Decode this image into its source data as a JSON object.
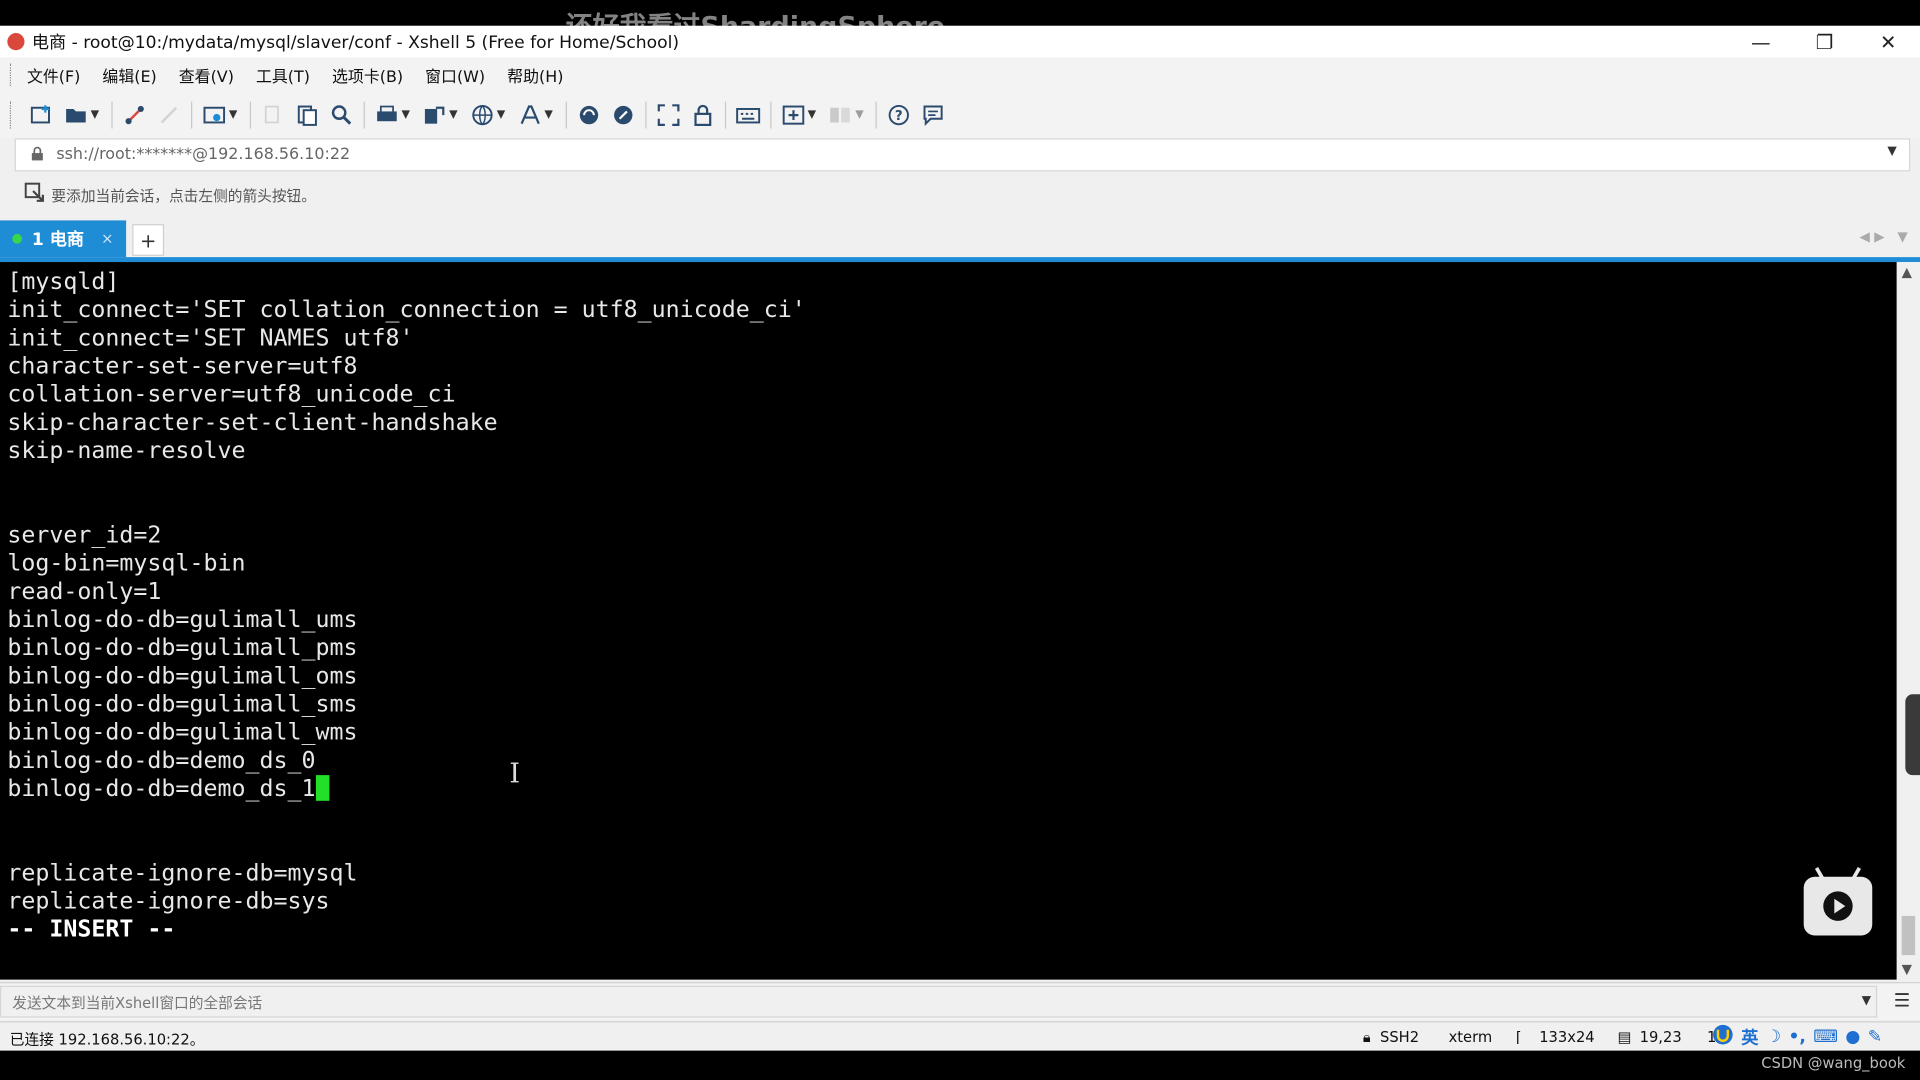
{
  "watermark": "还好我看过ShardingSphere",
  "window": {
    "title": "电商 - root@10:/mydata/mysql/slaver/conf - Xshell 5 (Free for Home/School)",
    "minimize": "—",
    "restore": "❐",
    "close": "✕"
  },
  "menu": [
    "文件(F)",
    "编辑(E)",
    "查看(V)",
    "工具(T)",
    "选项卡(B)",
    "窗口(W)",
    "帮助(H)"
  ],
  "address": {
    "value": "ssh://root:*******@192.168.56.10:22"
  },
  "hint": {
    "text": "要添加当前会话，点击左侧的箭头按钮。"
  },
  "tabs": [
    {
      "label": "1 电商",
      "close": "×"
    }
  ],
  "add_tab": "+",
  "terminal": {
    "lines": [
      "[mysqld]",
      "init_connect='SET collation_connection = utf8_unicode_ci'",
      "init_connect='SET NAMES utf8'",
      "character-set-server=utf8",
      "collation-server=utf8_unicode_ci",
      "skip-character-set-client-handshake",
      "skip-name-resolve",
      "",
      "",
      "server_id=2",
      "log-bin=mysql-bin",
      "read-only=1",
      "binlog-do-db=gulimall_ums",
      "binlog-do-db=gulimall_pms",
      "binlog-do-db=gulimall_oms",
      "binlog-do-db=gulimall_sms",
      "binlog-do-db=gulimall_wms",
      "binlog-do-db=demo_ds_0",
      "binlog-do-db=demo_ds_1",
      "",
      "",
      "replicate-ignore-db=mysql",
      "replicate-ignore-db=sys",
      "-- INSERT --"
    ],
    "cursor_line": 18,
    "cursor_color": "#22e02a"
  },
  "send_bar": {
    "placeholder": "发送文本到当前Xshell窗口的全部会话"
  },
  "status": {
    "connection": "已连接 192.168.56.10:22。",
    "protocol": "SSH2",
    "terminal_type": "xterm",
    "size": "133x24",
    "position": "19,23",
    "sessions": "1",
    "ime_lang": "英"
  },
  "footer": {
    "credit": "CSDN @wang_book"
  },
  "colors": {
    "accent": "#1f8cd6",
    "terminal_bg": "#000000",
    "terminal_fg": "#e8e8e8"
  }
}
